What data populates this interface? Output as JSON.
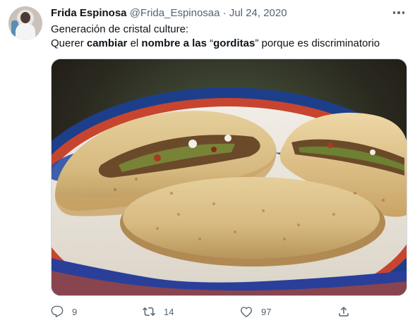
{
  "tweet": {
    "author_name": "Frida Espinosa",
    "handle": "@Frida_Espinosaa",
    "separator": "·",
    "date": "Jul 24, 2020",
    "line1": "Generación de cristal culture:",
    "line2": {
      "p1": "Querer ",
      "b1": "cambiar",
      "p2": " el ",
      "b2": "nombre a las",
      "p3": " “",
      "b3": "gorditas",
      "p4": "” porque es discriminatorio"
    },
    "media_icon": "photo-of-gorditas",
    "stats": {
      "replies": "9",
      "retweets": "14",
      "likes": "97"
    }
  },
  "icons": {
    "reply": "reply-icon",
    "retweet": "retweet-icon",
    "like": "heart-icon",
    "share": "share-icon",
    "more": "more-icon"
  },
  "colors": {
    "text": "#0f1419",
    "secondary": "#536471",
    "border": "#cfd9de"
  }
}
